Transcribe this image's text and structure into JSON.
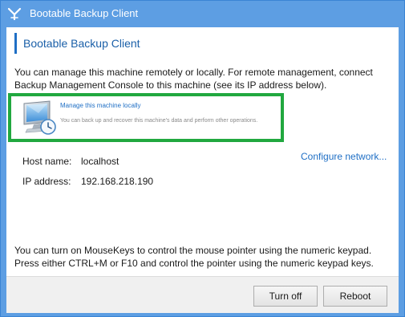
{
  "window": {
    "title": "Bootable Backup Client",
    "title_icon": "acronis-logo-icon"
  },
  "main": {
    "heading": "Bootable Backup Client",
    "intro_line1": "You can manage this machine remotely or locally. For remote management, connect",
    "intro_line2": "Backup Management Console to this machine (see its IP address below).",
    "manage_option": {
      "icon": "computer-clock-icon",
      "title": "Manage this machine locally",
      "description": "You can back up and recover this machine's data and perform other operations."
    },
    "configure_link": "Configure network...",
    "host": {
      "label": "Host name:",
      "value": "localhost"
    },
    "ip": {
      "label": "IP address:",
      "value": "192.168.218.190"
    },
    "hint_line1": "You can turn on MouseKeys to control the mouse pointer using the numeric keypad.",
    "hint_line2": "Press either CTRL+M or F10 and control the pointer using the numeric keypad keys."
  },
  "footer": {
    "turn_off_label": "Turn off",
    "reboot_label": "Reboot"
  },
  "colors": {
    "titlebar": "#5d9ee3",
    "link": "#1f6fc5",
    "highlight_border": "#21a83f",
    "footer_bg": "#f0f0f0"
  }
}
